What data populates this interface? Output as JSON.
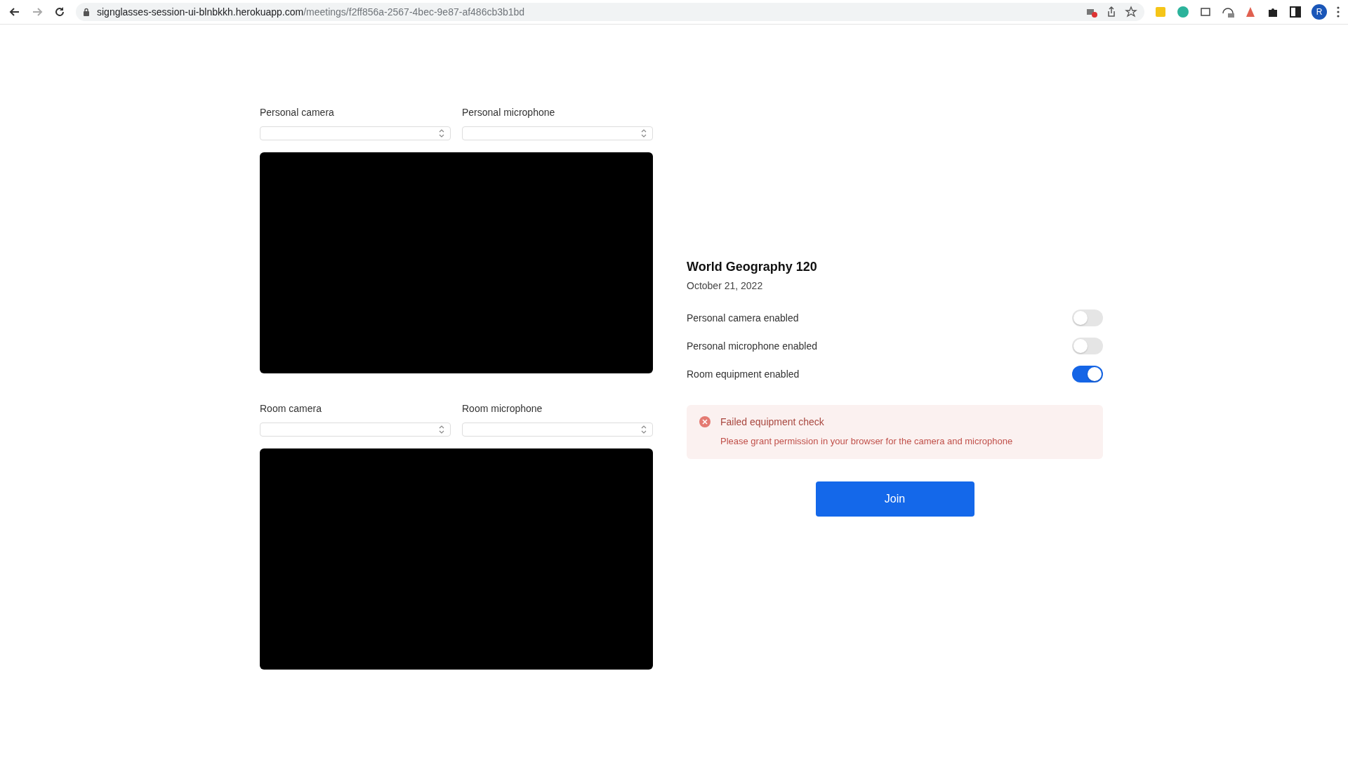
{
  "browser": {
    "url_host": "signglasses-session-ui-blnbkkh.herokuapp.com",
    "url_path": "/meetings/f2ff856a-2567-4bec-9e87-af486cb3b1bd",
    "profile_initial": "R"
  },
  "devices": [
    {
      "camera_label": "Personal camera",
      "microphone_label": "Personal microphone"
    },
    {
      "camera_label": "Room camera",
      "microphone_label": "Room microphone"
    }
  ],
  "meeting": {
    "title": "World Geography 120",
    "date": "October 21, 2022"
  },
  "toggles": [
    {
      "label": "Personal camera enabled",
      "on": false
    },
    {
      "label": "Personal microphone enabled",
      "on": false
    },
    {
      "label": "Room equipment enabled",
      "on": true
    }
  ],
  "alert": {
    "title": "Failed equipment check",
    "message": "Please grant permission in your browser for the camera and microphone"
  },
  "join_button": "Join"
}
